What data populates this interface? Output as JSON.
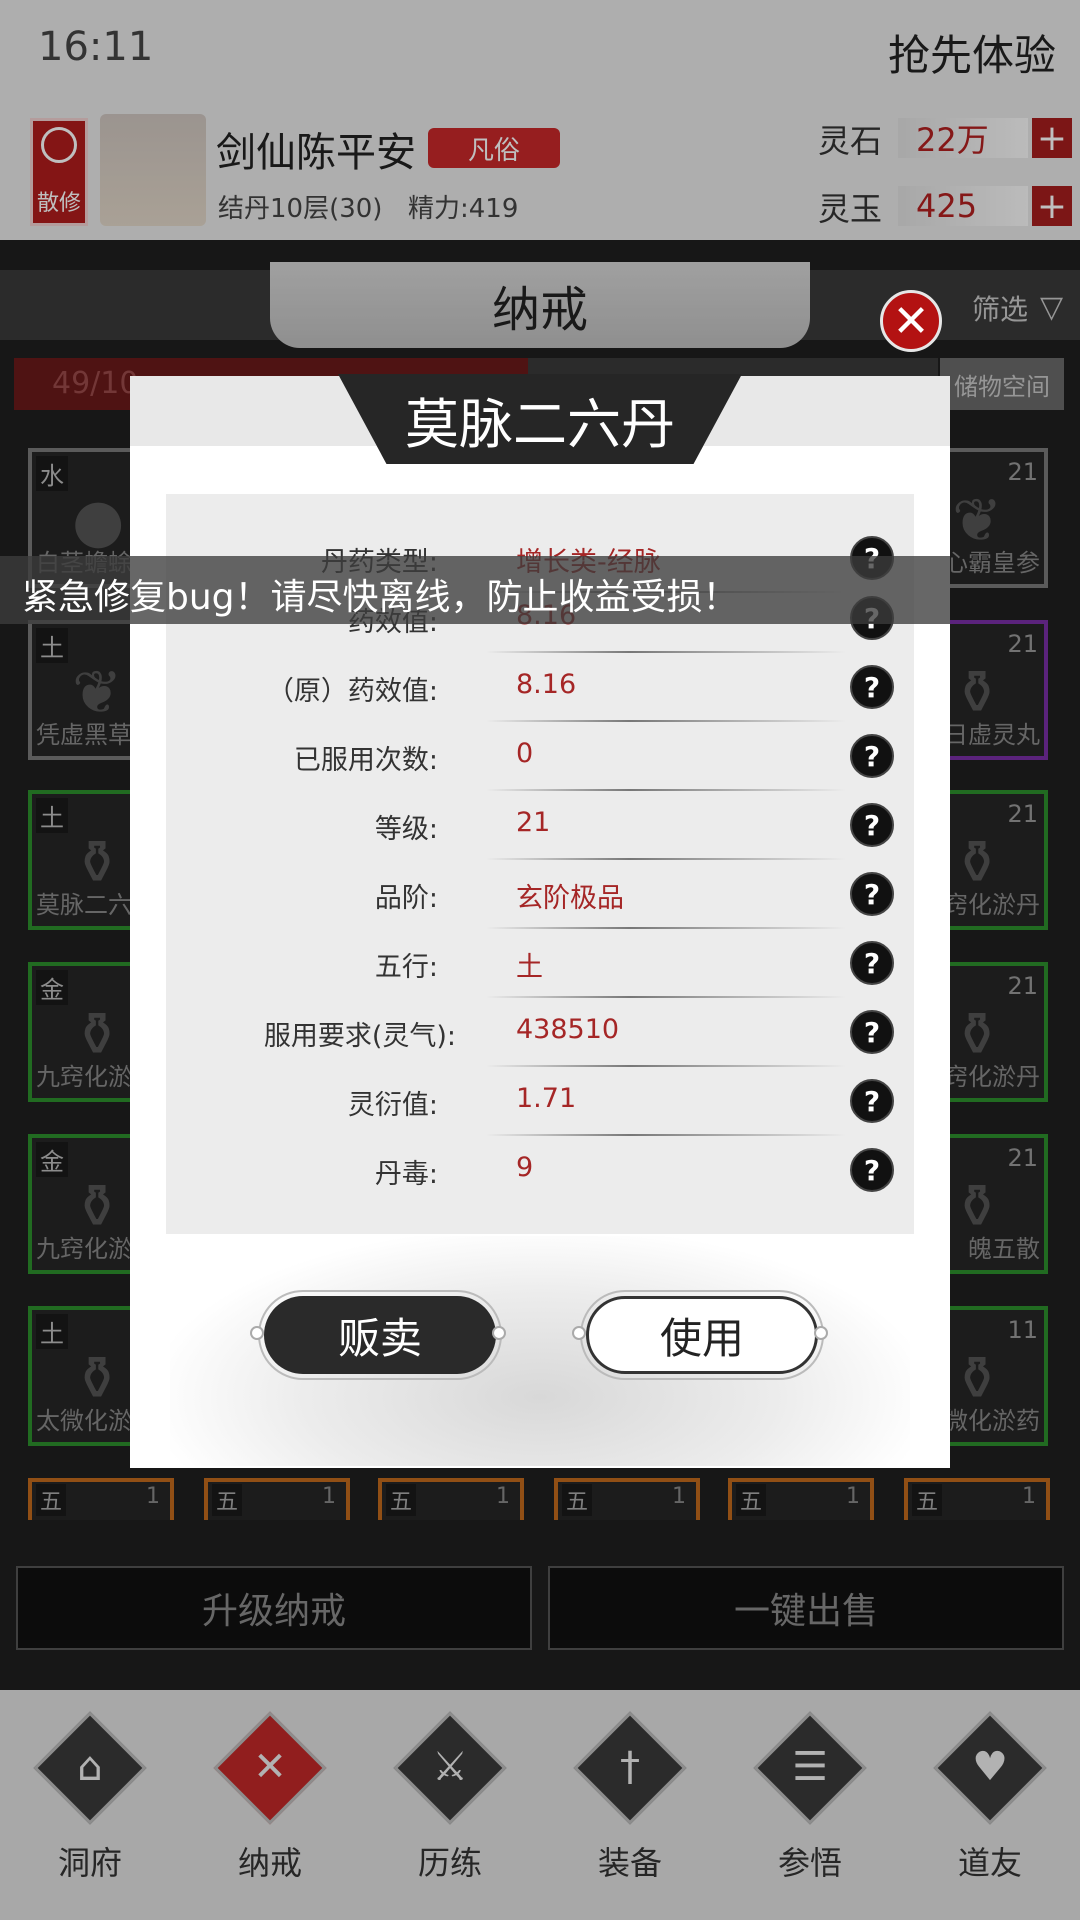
{
  "status": {
    "time": "16:11",
    "action": "抢先体验"
  },
  "player": {
    "sect": "散修",
    "name": "剑仙陈平安",
    "rank": "凡俗",
    "level": "结丹10层(30)",
    "energy": "精力:419"
  },
  "resources": [
    {
      "label": "灵石",
      "value": "22万"
    },
    {
      "label": "灵玉",
      "value": "425"
    }
  ],
  "panel": {
    "title": "纳戒",
    "filter": "筛选",
    "capacity": "49/10",
    "storage": "储物空间"
  },
  "slots_left": [
    {
      "element": "水",
      "name": "白茎蟾蜍"
    },
    {
      "element": "土",
      "name": "凭虚黑草"
    },
    {
      "element": "土",
      "name": "莫脉二六"
    },
    {
      "element": "金",
      "name": "九窍化淤"
    },
    {
      "element": "金",
      "name": "九窍化淤"
    },
    {
      "element": "土",
      "name": "太微化淤"
    }
  ],
  "slots_right": [
    {
      "level": "21",
      "name": "心霸皇参"
    },
    {
      "level": "21",
      "name": "日虚灵丸"
    },
    {
      "level": "21",
      "name": "窍化淤丹"
    },
    {
      "level": "21",
      "name": "窍化淤丹"
    },
    {
      "level": "21",
      "name": "魄五散"
    },
    {
      "level": "11",
      "name": "微化淤药"
    }
  ],
  "mini_slots": [
    {
      "element": "五",
      "qty": "1"
    },
    {
      "element": "五",
      "qty": "1"
    },
    {
      "element": "五",
      "qty": "1"
    },
    {
      "element": "五",
      "qty": "1"
    },
    {
      "element": "五",
      "qty": "1"
    },
    {
      "element": "五",
      "qty": "1"
    }
  ],
  "bottom_buttons": {
    "upgrade": "升级纳戒",
    "sell_all": "一键出售"
  },
  "nav": [
    {
      "label": "洞府",
      "icon": "cave-icon",
      "glyph": "⌂"
    },
    {
      "label": "纳戒",
      "icon": "ring-icon",
      "glyph": "✕"
    },
    {
      "label": "历练",
      "icon": "crossed-swords-icon",
      "glyph": "⚔"
    },
    {
      "label": "装备",
      "icon": "sword-icon",
      "glyph": "†"
    },
    {
      "label": "参悟",
      "icon": "book-icon",
      "glyph": "☰"
    },
    {
      "label": "道友",
      "icon": "handshake-icon",
      "glyph": "♥"
    }
  ],
  "modal": {
    "title": "莫脉二六丹",
    "rows": [
      {
        "label": "丹药类型:",
        "value": "增长类-经脉"
      },
      {
        "label": "药效值:",
        "value": "8.16"
      },
      {
        "label": "（原）药效值:",
        "value": "8.16"
      },
      {
        "label": "已服用次数:",
        "value": "0"
      },
      {
        "label": "等级:",
        "value": "21"
      },
      {
        "label": "品阶:",
        "value": "玄阶极品"
      },
      {
        "label": "五行:",
        "value": "土"
      },
      {
        "label": "服用要求(灵气):",
        "value": "438510"
      },
      {
        "label": "灵衍值:",
        "value": "1.71"
      },
      {
        "label": "丹毒:",
        "value": "9"
      }
    ],
    "sell": "贩卖",
    "use": "使用"
  },
  "banner": "紧急修复bug！请尽快离线，防止收益受损！",
  "colors": {
    "accent_red": "#b31212",
    "value_red": "#a52626",
    "rarity_green": "#2c8f2c",
    "rarity_purple": "#7a2fa6",
    "rarity_orange": "#c26a1d"
  }
}
